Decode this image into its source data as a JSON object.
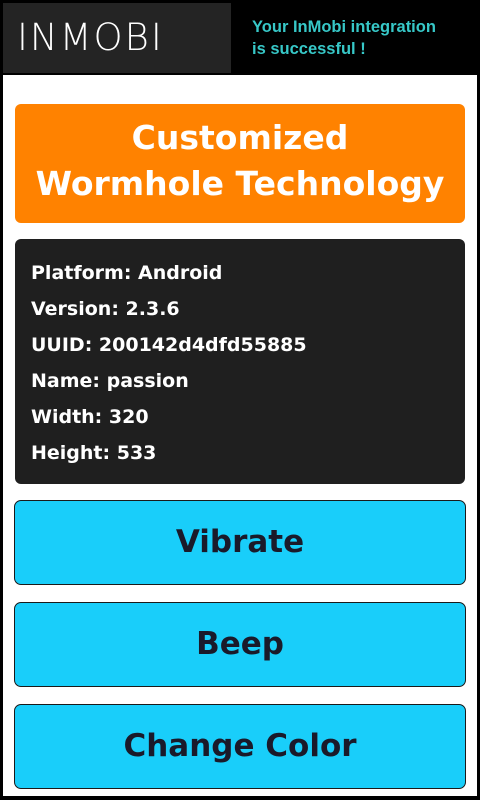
{
  "ad_banner": {
    "logo": "INMOBI",
    "message": "Your InMobi integration\nis successful !"
  },
  "header": {
    "line1": "Customized",
    "line2": "Wormhole Technology"
  },
  "device_info": {
    "platform": "Platform: Android",
    "version": "Version: 2.3.6",
    "uuid": "UUID: 200142d4dfd55885",
    "name": "Name: passion",
    "width": "Width: 320",
    "height": "Height: 533"
  },
  "buttons": {
    "vibrate": "Vibrate",
    "beep": "Beep",
    "change_color": "Change Color"
  },
  "colors": {
    "header_bg": "#ff8200",
    "info_bg": "#1f1f1f",
    "button_bg": "#19cefa",
    "banner_text": "#37c8c8"
  }
}
